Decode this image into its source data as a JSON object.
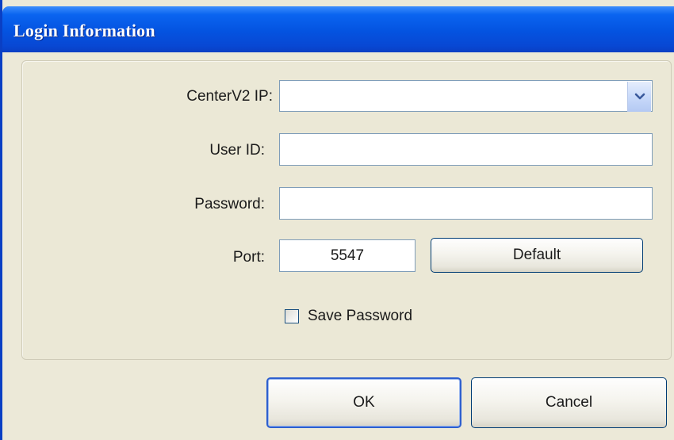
{
  "window": {
    "title": "Login Information"
  },
  "form": {
    "center_ip_label": "CenterV2 IP:",
    "center_ip_value": "",
    "user_id_label": "User ID:",
    "user_id_value": "",
    "password_label": "Password:",
    "password_value": "",
    "port_label": "Port:",
    "port_value": "5547",
    "default_button": "Default",
    "save_password_label": "Save Password",
    "save_password_checked": false
  },
  "footer": {
    "ok_button": "OK",
    "cancel_button": "Cancel"
  },
  "icons": {
    "combo_arrow": "chevron-down-icon",
    "checkbox": "checkbox-unchecked-icon"
  },
  "colors": {
    "titlebar": "#0453e0",
    "dialog_bg": "#ece9d8",
    "field_border": "#7f9db9",
    "button_border": "#003c74"
  }
}
